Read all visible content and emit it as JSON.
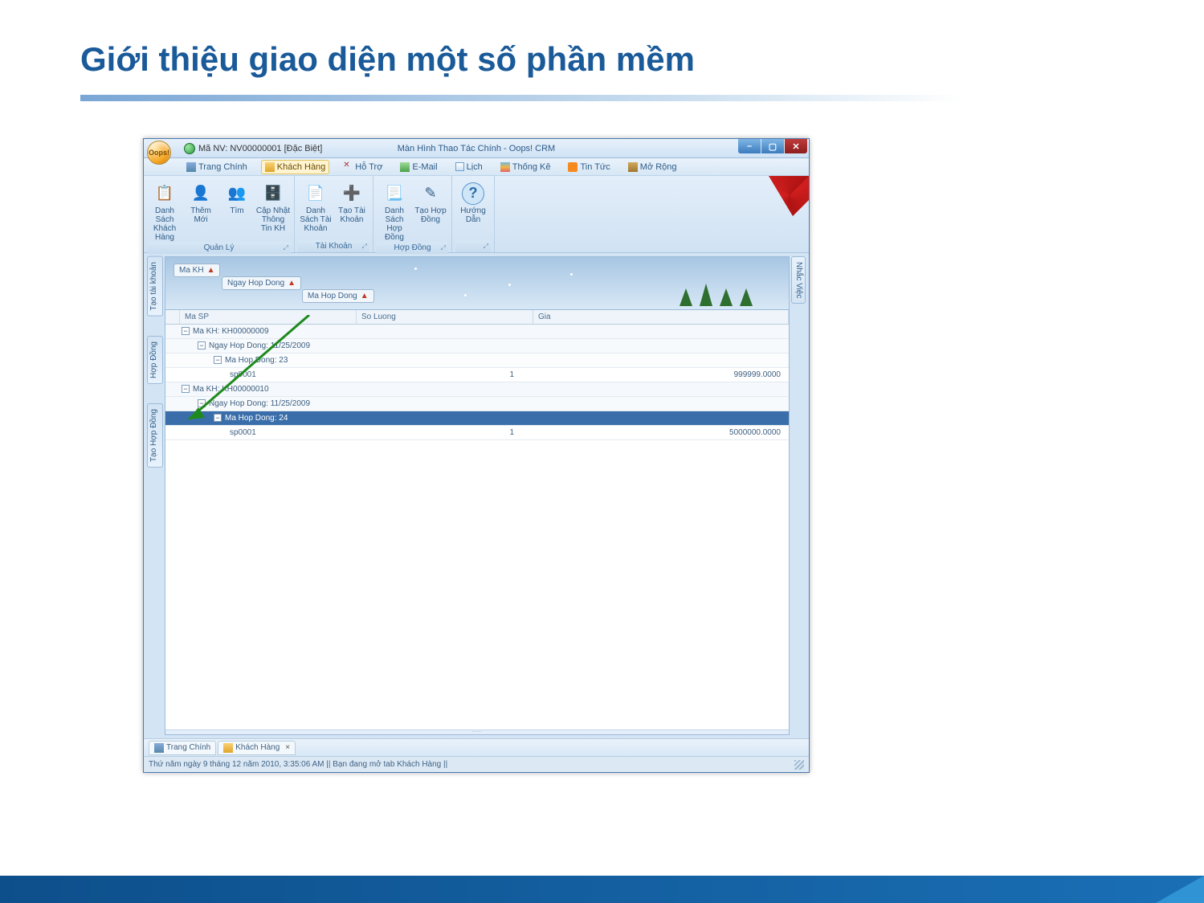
{
  "page": {
    "title": "Giới thiệu giao diện một số phần mềm"
  },
  "crm": {
    "orb": "Oops!",
    "title_left": "Mã NV: NV00000001 [Đặc Biệt]",
    "title_center": "Màn Hình Thao Tác Chính - Oops! CRM",
    "menu": {
      "trang_chinh": "Trang Chính",
      "khach_hang": "Khách Hàng",
      "ho_tro": "Hỗ Trợ",
      "email": "E-Mail",
      "lich": "Lịch",
      "thong_ke": "Thống Kê",
      "tin_tuc": "Tin Tức",
      "mo_rong": "Mở Rộng"
    },
    "ribbon": {
      "dskh": "Danh Sách Khách Hàng",
      "them": "Thêm Mới",
      "tim": "Tìm",
      "capnhat": "Cập Nhật Thông Tin KH",
      "quanly": "Quản Lý",
      "dstk": "Danh Sách Tài Khoản",
      "ttk": "Tạo Tài Khoản",
      "taikhoan": "Tài Khoản",
      "dshd": "Danh Sách Hợp Đồng",
      "thd": "Tạo Hợp Đồng",
      "hopdong": "Hợp Đồng",
      "huongdan": "Hướng Dẫn"
    },
    "pills": {
      "makh": "Ma KH",
      "ngayhd": "Ngay Hop Dong",
      "mahd": "Ma Hop Dong"
    },
    "cols": {
      "masp": "Ma SP",
      "sl": "So Luong",
      "gia": "Gia"
    },
    "rows": {
      "g1": "Ma KH: KH00000009",
      "g1a": "Ngay Hop Dong: 11/25/2009",
      "g1b": "Ma Hop Dong: 23",
      "g1_sp": "sp0001",
      "g1_sl": "1",
      "g1_gia": "999999.0000",
      "g2": "Ma KH: KH00000010",
      "g2a": "Ngay Hop Dong: 11/25/2009",
      "g2b": "Ma Hop Dong: 24",
      "g2_sp": "sp0001",
      "g2_sl": "1",
      "g2_gia": "5000000.0000"
    },
    "vtabs": {
      "ttk": "Tạo tài khoản",
      "hd": "Hợp Đồng",
      "thd": "Tạo Hợp Đồng",
      "nhac": "Nhắc Việc"
    },
    "bottom_tabs": {
      "trang": "Trang Chính",
      "kh": "Khách Hàng"
    },
    "status": "Thứ năm ngày 9 tháng 12 năm 2010, 3:35:06 AM  || Bạn đang mở tab Khách Hàng ||"
  }
}
